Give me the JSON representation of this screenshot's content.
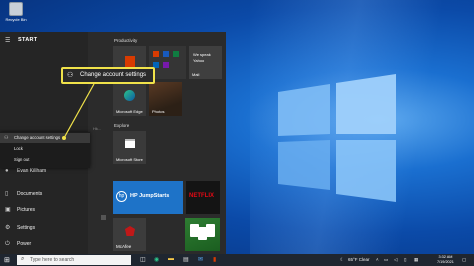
{
  "desktop": {
    "recycle_bin_label": "Recycle Bin"
  },
  "start_menu": {
    "title": "START",
    "account_menu": [
      {
        "label": "Change account settings",
        "icon": "person-gear-icon"
      },
      {
        "label": "Lock",
        "icon": "lock-icon"
      },
      {
        "label": "Sign out",
        "icon": "sign-out-icon"
      }
    ],
    "background_tag": "Hk...",
    "left_items": [
      {
        "label": "Evan Killham",
        "icon": "user-icon"
      },
      {
        "label": "Documents",
        "icon": "document-icon"
      },
      {
        "label": "Pictures",
        "icon": "pictures-icon"
      },
      {
        "label": "Settings",
        "icon": "gear-icon"
      },
      {
        "label": "Power",
        "icon": "power-icon"
      }
    ],
    "groups": {
      "productivity": "Productivity",
      "explore": "Explore"
    },
    "tiles": {
      "mail_line1": "We speak",
      "mail_line2": "Yahoo",
      "mail_label": "Mail",
      "edge": "Microsoft Edge",
      "photos": "Photos",
      "store": "Microsoft Store",
      "hp": "HP JumpStarts",
      "netflix": "NETFLIX",
      "mcafee": "McAfee"
    }
  },
  "callout": {
    "text": "Change account settings"
  },
  "taskbar": {
    "search_placeholder": "Type here to search",
    "weather": "65°F Clear",
    "time": "3:32 AM",
    "date": "7/19/2021"
  },
  "colors": {
    "callout_border": "#f0e24a",
    "netflix": "#e50914",
    "hp_tile": "#1e73c8"
  }
}
